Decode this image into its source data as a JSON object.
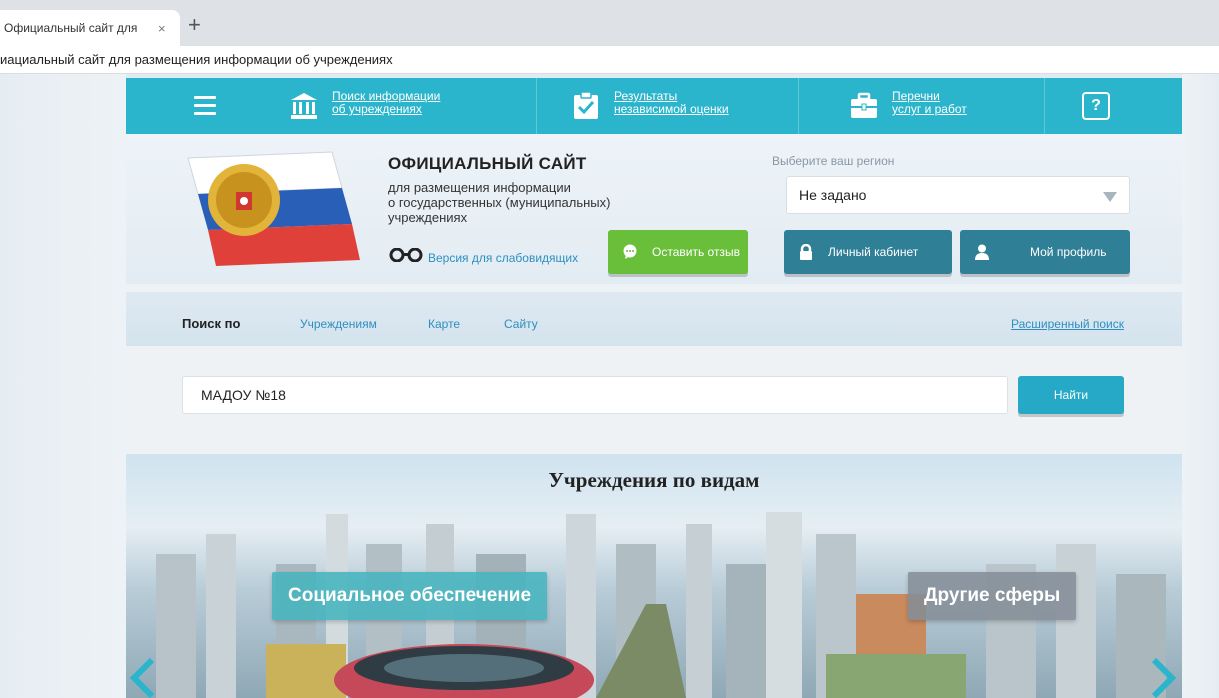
{
  "browser": {
    "tab_title": "Официальный сайт для",
    "tab_close": "×",
    "new_tab": "+",
    "address": "иациальный сайт для размещения информации об учреждениях"
  },
  "topnav": {
    "items": [
      {
        "label": "Поиск информации\nоб учреждениях",
        "icon": "institution-icon"
      },
      {
        "label": "Результаты\nнезависимой оценки",
        "icon": "checklist-icon"
      },
      {
        "label": "Перечни\nуслуг и работ",
        "icon": "briefcase-icon"
      }
    ],
    "help": "?"
  },
  "header": {
    "title": "ОФИЦИАЛЬНЫЙ САЙТ",
    "subtitle": "для размещения информации\nо государственных (муниципальных)\nучреждениях",
    "low_vision": "Версия для слабовидящих",
    "region_label": "Выберите ваш регион",
    "region_value": "Не задано",
    "buttons": {
      "feedback": "Оставить отзыв",
      "cabinet": "Личный кабинет",
      "profile": "Мой профиль"
    }
  },
  "search": {
    "by_label": "Поиск по",
    "tabs": [
      "Учреждениям",
      "Карте",
      "Сайту"
    ],
    "advanced": "Расширенный поиск",
    "value": "МАДОУ №18",
    "button": "Найти"
  },
  "banner": {
    "title": "Учреждения по видам",
    "chips": [
      "Социальное обеспечение",
      "Другие сферы"
    ]
  },
  "colors": {
    "accent": "#2bb5cc",
    "green": "#6abf3a",
    "dark_teal": "#2f7f96",
    "link": "#2e8fbf"
  }
}
